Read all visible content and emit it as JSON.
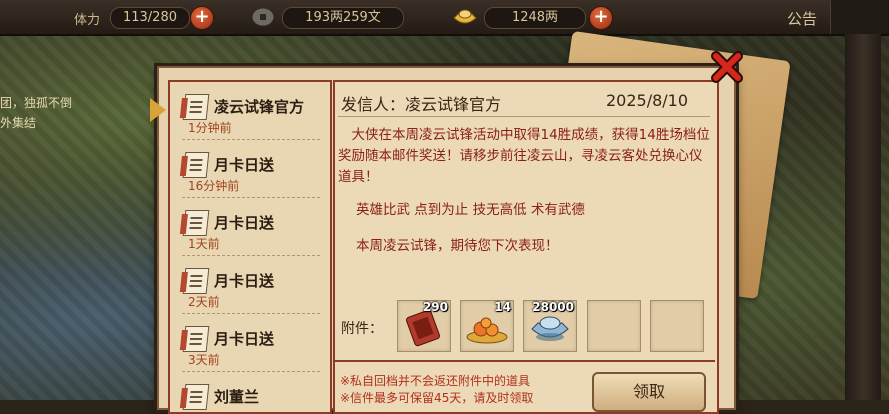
{
  "topbar": {
    "stamina_label": "体力",
    "stamina_value": "113/280",
    "copper_value": "193两259文",
    "gold_value": "1248两",
    "notice_label": "公告"
  },
  "background_text": {
    "line1": "团，独孤不倒",
    "line2": "外集结"
  },
  "mail_list": [
    {
      "title": "凌云试锋官方",
      "time": "1分钟前"
    },
    {
      "title": "月卡日送",
      "time": "16分钟前"
    },
    {
      "title": "月卡日送",
      "time": "1天前"
    },
    {
      "title": "月卡日送",
      "time": "2天前"
    },
    {
      "title": "月卡日送",
      "time": "3天前"
    },
    {
      "title": "刘董兰",
      "time": ""
    }
  ],
  "mail_detail": {
    "sender_label": "发信人：凌云试锋官方",
    "date": "2025/8/10",
    "body": "大侠在本周凌云试锋活动中取得14胜成绩，获得14胜场档位奖励随本邮件奖送！请移步前往凌云山，寻凌云客处兑换心仪道具！",
    "motto": "英雄比武  点到为止  技无高低  术有武德",
    "closing": "本周凌云试锋，期待您下次表现！",
    "attachment_label": "附件：",
    "attachments": [
      {
        "icon": "red-token-icon",
        "qty": "290"
      },
      {
        "icon": "fruit-plate-icon",
        "qty": "14"
      },
      {
        "icon": "silver-ingot-icon",
        "qty": "28000"
      },
      {
        "icon": "empty-slot",
        "qty": ""
      },
      {
        "icon": "empty-slot",
        "qty": ""
      }
    ],
    "note1": "※私自回档并不会返还附件中的道具",
    "note2": "※信件最多可保留45天，请及时领取",
    "claim_label": "领取"
  },
  "colors": {
    "accent_red": "#8a1f12",
    "paper": "#e6d2ae",
    "border": "#8b3b28"
  }
}
